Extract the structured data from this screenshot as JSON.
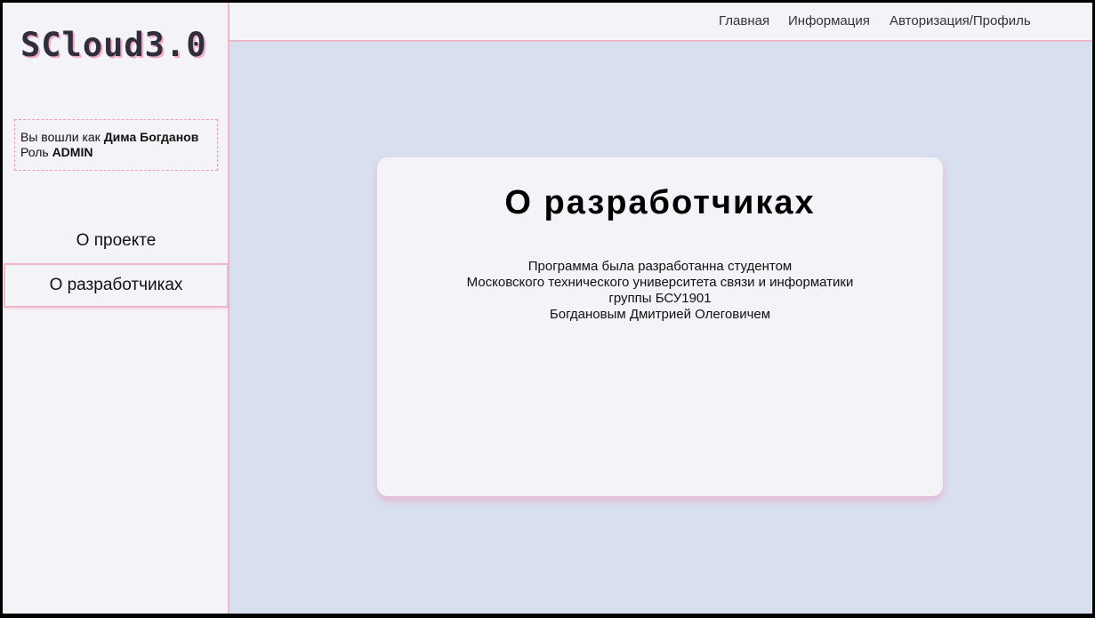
{
  "app": {
    "logo": "SCloud3.0"
  },
  "user": {
    "logged_prefix": "Вы вошли как",
    "name": "Дима Богданов",
    "role_prefix": "Роль",
    "role": "ADMIN"
  },
  "sidebar": {
    "items": [
      {
        "label": "О проекте",
        "active": false
      },
      {
        "label": "О разработчиках",
        "active": true
      }
    ]
  },
  "topnav": {
    "items": [
      {
        "label": "Главная"
      },
      {
        "label": "Информация"
      },
      {
        "label": "Авторизация/Профиль"
      }
    ]
  },
  "main": {
    "title": "О разработчиках",
    "lines": [
      "Программа была разработанна студентом",
      "Московского технического университета связи и информатики",
      "группы БСУ1901",
      "Богдановым Дмитрией Олеговичем"
    ]
  },
  "colors": {
    "background": "#d8e0f0",
    "panel": "#f3f3f8",
    "accent_border": "#f1b6c8",
    "logo_shadow": "#f3a6c0"
  }
}
